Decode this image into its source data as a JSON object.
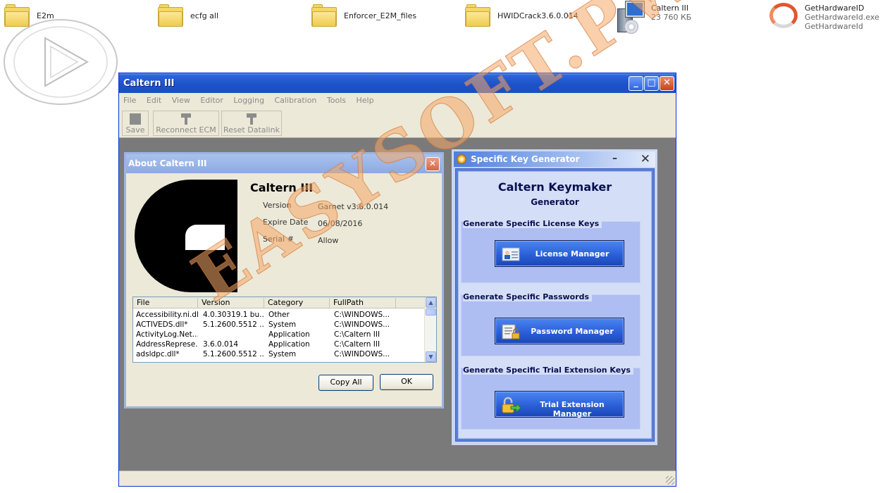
{
  "desktop": {
    "icons": [
      {
        "label": "E2m",
        "icon": "folder-icon"
      },
      {
        "label": "ecfg all",
        "icon": "folder-icon"
      },
      {
        "label": "Enforcer_E2M_files",
        "icon": "folder-icon"
      },
      {
        "label": "HWIDCrack3.6.0.014",
        "icon": "folder-icon"
      }
    ],
    "installer": {
      "name": "Caltern  III",
      "size": "23 760 КБ",
      "icon": "installer-icon"
    },
    "hwid": {
      "name": "GetHardwareID",
      "file": "GetHardwareId.exe",
      "desc": "GetHardwareId",
      "icon": "hwid-icon"
    }
  },
  "main_window": {
    "title": "Caltern III",
    "menu": [
      "File",
      "Edit",
      "View",
      "Editor",
      "Logging",
      "Calibration",
      "Tools",
      "Help"
    ],
    "toolbar": {
      "save": "Save",
      "reconnect": "Reconnect ECM",
      "reset": "Reset Datalink"
    }
  },
  "about_dialog": {
    "title": "About Caltern III",
    "product": "Caltern III",
    "version_label": "Version",
    "version_value": "Garnet v3.6.0.014",
    "expire_label": "Expire Date",
    "expire_value": "06/08/2016",
    "serial_label": "Serial #",
    "serial_value": "Allow",
    "columns": [
      "File",
      "Version",
      "Category",
      "FullPath"
    ],
    "rows": [
      [
        "Accessibility.ni.dll*",
        "4.0.30319.1 bu...",
        "Other",
        "C:\\WINDOWS..."
      ],
      [
        "ACTIVEDS.dll*",
        "5.1.2600.5512 ...",
        "System",
        "C:\\WINDOWS..."
      ],
      [
        "ActivityLog.Net....",
        "",
        "Application",
        "C:\\Caltern III"
      ],
      [
        "AddressReprese...",
        "3.6.0.014",
        "Application",
        "C:\\Caltern III"
      ],
      [
        "adsldpc.dll*",
        "5.1.2600.5512 ...",
        "System",
        "C:\\WINDOWS..."
      ]
    ],
    "copy_all": "Copy All",
    "ok": "OK"
  },
  "keygen": {
    "title": "Specific Key Generator",
    "heading": "Caltern Keymaker",
    "subheading": "Generator",
    "groups": [
      {
        "label": "Generate Specific License Keys",
        "button": "License Manager"
      },
      {
        "label": "Generate Specific Passwords",
        "button": "Password Manager"
      },
      {
        "label": "Generate Specific Trial Extension Keys",
        "button": "Trial Extension Manager"
      }
    ]
  },
  "watermark": "EASYSOFT.PW",
  "colors": {
    "xp_title": "#1d51c9",
    "dialog_bg": "#ece9d8",
    "keygen_button": "#2b5fd8",
    "watermark": "#f5a866"
  }
}
